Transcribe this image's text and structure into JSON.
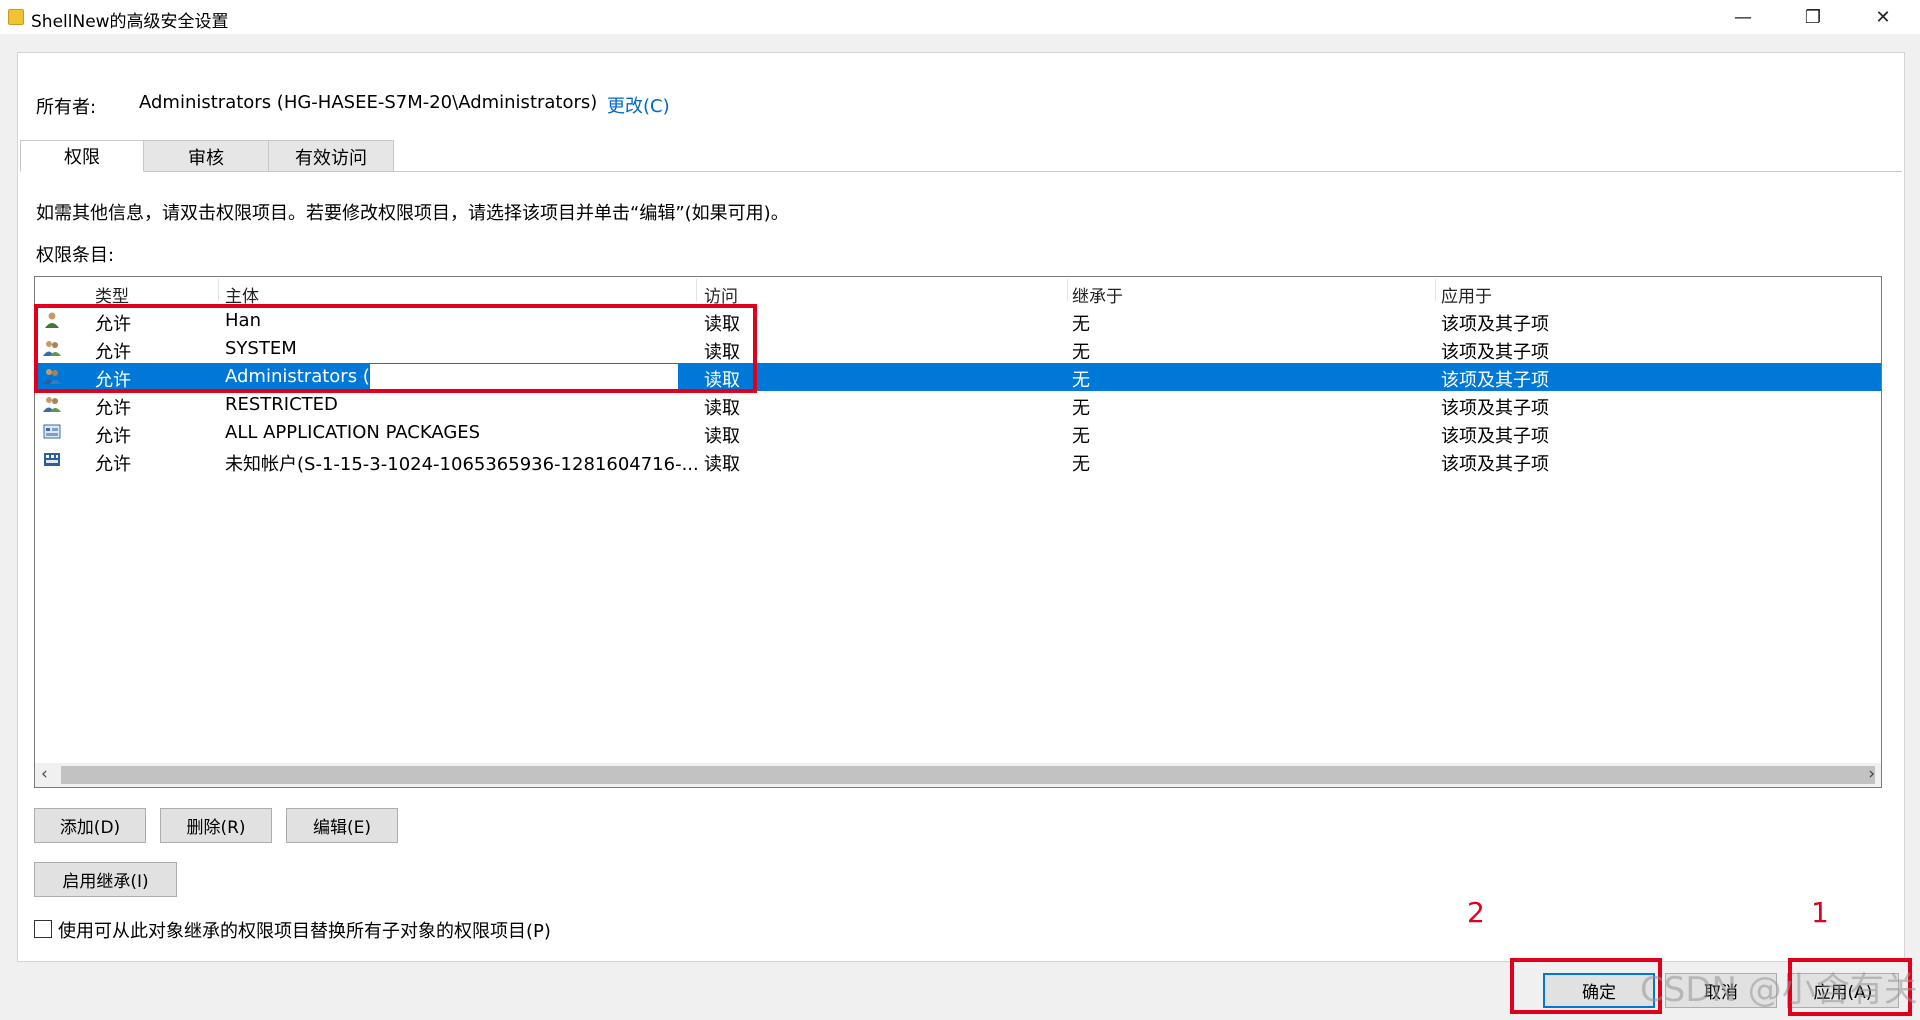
{
  "window": {
    "title": "ShellNew的高级安全设置",
    "minimize": "—",
    "restore": "❐",
    "close": "✕"
  },
  "owner": {
    "label": "所有者:",
    "value": "Administrators (HG-HASEE-S7M-20\\Administrators)",
    "change": "更改(C)"
  },
  "tabs": [
    {
      "label": "权限",
      "active": true
    },
    {
      "label": "审核",
      "active": false
    },
    {
      "label": "有效访问",
      "active": false
    }
  ],
  "info_text": "如需其他信息，请双击权限项目。若要修改权限项目，请选择该项目并单击“编辑”(如果可用)。",
  "entries_label": "权限条目:",
  "table": {
    "columns": [
      "类型",
      "主体",
      "访问",
      "继承于",
      "应用于"
    ],
    "rows": [
      {
        "icon": "user-icon",
        "type": "允许",
        "principal": "Han",
        "access": "读取",
        "inherited": "无",
        "applies": "该项及其子项"
      },
      {
        "icon": "group-icon",
        "type": "允许",
        "principal": "SYSTEM",
        "access": "读取",
        "inherited": "无",
        "applies": "该项及其子项"
      },
      {
        "icon": "group-icon",
        "type": "允许",
        "principal": "Administrators (H",
        "access": "读取",
        "inherited": "无",
        "applies": "该项及其子项",
        "selected": true
      },
      {
        "icon": "group-icon",
        "type": "允许",
        "principal": "RESTRICTED",
        "access": "读取",
        "inherited": "无",
        "applies": "该项及其子项"
      },
      {
        "icon": "app-package-icon",
        "type": "允许",
        "principal": "ALL APPLICATION PACKAGES",
        "access": "读取",
        "inherited": "无",
        "applies": "该项及其子项"
      },
      {
        "icon": "unknown-account-icon",
        "type": "允许",
        "principal": "未知帐户(S-1-15-3-1024-1065365936-1281604716-...",
        "access": "读取",
        "inherited": "无",
        "applies": "该项及其子项"
      }
    ]
  },
  "scroll": {
    "left": "‹",
    "right": "›"
  },
  "buttons": {
    "add": "添加(D)",
    "remove": "删除(R)",
    "edit": "编辑(E)",
    "enable_inheritance": "启用继承(I)",
    "ok": "确定",
    "cancel": "取消",
    "apply": "应用(A)"
  },
  "replace_checkbox": {
    "label": "使用可从此对象继承的权限项目替换所有子对象的权限项目(P)",
    "checked": false
  },
  "annotations": {
    "step1": "1",
    "step2": "2",
    "color": "#e0001b"
  },
  "watermark": "CSDN @小含有关",
  "colors": {
    "selection": "#0078d7",
    "link": "#0066cc"
  }
}
